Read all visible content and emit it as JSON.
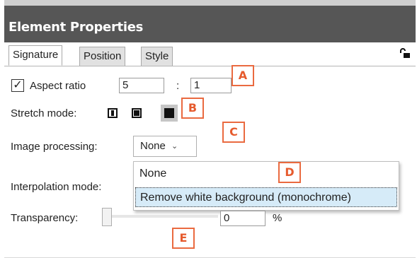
{
  "header": {
    "title": "Element Properties"
  },
  "tabs": [
    {
      "label": "Signature",
      "active": true
    },
    {
      "label": "Position",
      "active": false
    },
    {
      "label": "Style",
      "active": false
    }
  ],
  "lock_icon": "unlocked-padlock-icon",
  "aspect_ratio": {
    "checked": true,
    "check_glyph": "✓",
    "label": "Aspect ratio",
    "value_left": "5",
    "separator": ":",
    "value_right": "1"
  },
  "stretch_mode": {
    "label": "Stretch mode:",
    "options": [
      "stretch-fit-icon",
      "stretch-fill-icon",
      "stretch-crop-icon"
    ],
    "selected_index": 2
  },
  "image_processing": {
    "label": "Image processing:",
    "selected": "None",
    "chevron": "⌄",
    "options": [
      "None",
      "Remove white background (monochrome)"
    ],
    "highlighted_index": 1
  },
  "interpolation_mode": {
    "label": "Interpolation mode:"
  },
  "transparency": {
    "label": "Transparency:",
    "value": "0",
    "unit": "%",
    "level": 0
  },
  "annotations": {
    "a": "A",
    "b": "B",
    "c": "C",
    "d": "D",
    "e": "E"
  },
  "colors": {
    "header_bg": "#565656",
    "annotation": "#ea6a40",
    "highlight": "#d6ebf8"
  }
}
